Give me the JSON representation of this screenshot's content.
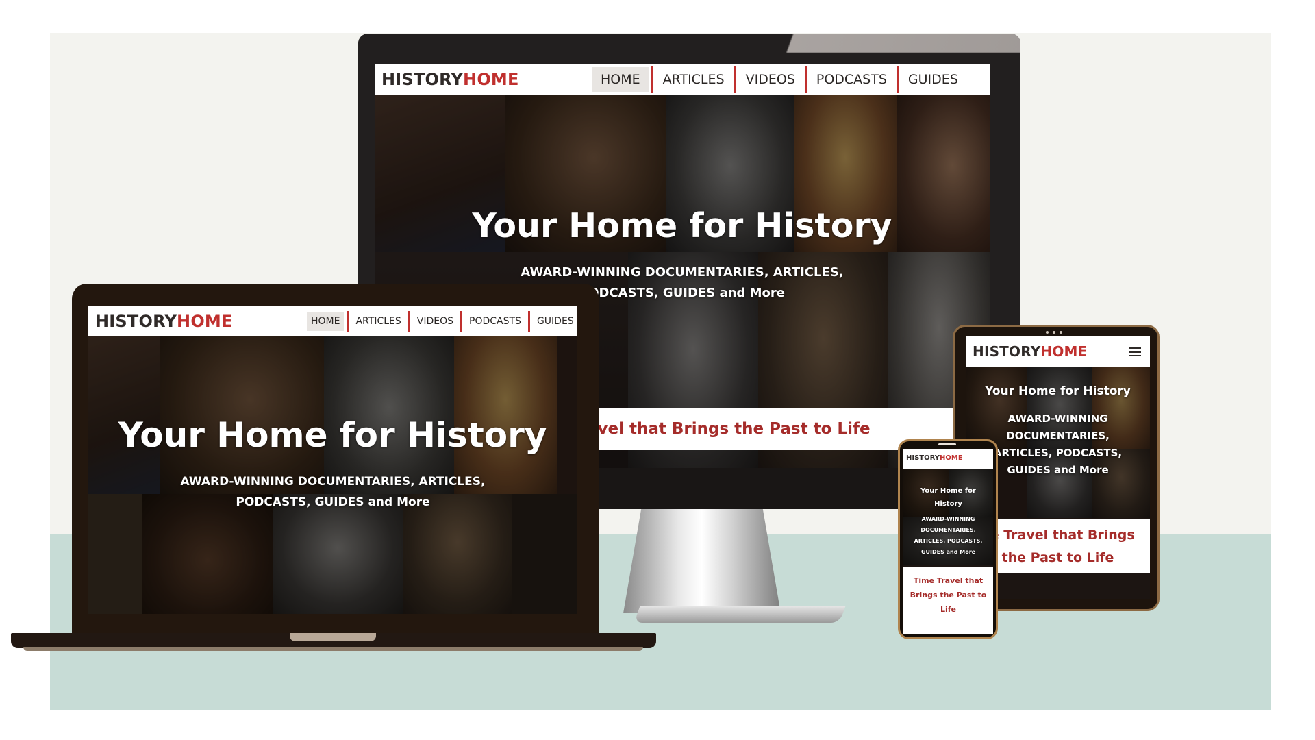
{
  "site": {
    "brand_part1": "HISTORY",
    "brand_part2": "HOME",
    "nav": [
      "HOME",
      "ARTICLES",
      "VIDEOS",
      "PODCASTS",
      "GUIDES"
    ],
    "hero_title": "Your Home for History",
    "hero_subtitle": "AWARD-WINNING DOCUMENTARIES, ARTICLES, PODCASTS, GUIDES and More",
    "tagline": "Time Travel that Brings the Past to Life"
  },
  "desktop": {
    "tagline_visible": "avel that Brings the Past to Life"
  },
  "tablet": {
    "tagline_line1": "ne Travel that Brings",
    "tagline_line2": "the Past to Life"
  },
  "phone": {
    "hero_title": "Your Home for History",
    "hero_subtitle": "AWARD-WINNING DOCUMENTARIES, ARTICLES, PODCASTS, GUIDES and More",
    "tagline": "Time Travel that Brings the Past to Life"
  },
  "colors": {
    "brand_red": "#c0302e",
    "brand_dark": "#2f2a28",
    "tagline_red": "#a52c2a",
    "page_top": "#f3f3ef",
    "page_bottom": "#c7dcd6"
  }
}
